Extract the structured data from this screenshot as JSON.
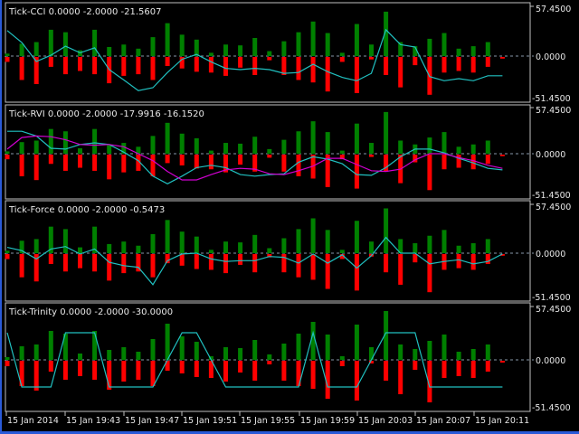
{
  "colors": {
    "background": "#000000",
    "frame": "#c0c0c0",
    "zero_line": "#8899aa",
    "bull": "#008000",
    "bear": "#ff0000",
    "line1": "#20c0c0",
    "line2": "#d000d0",
    "window_border": "#2a5ad8"
  },
  "time_axis": {
    "labels": [
      "15 Jan 2014",
      "15 Jan 19:43",
      "15 Jan 19:47",
      "15 Jan 19:51",
      "15 Jan 19:55",
      "15 Jan 19:59",
      "15 Jan 20:03",
      "15 Jan 20:07",
      "15 Jan 20:11"
    ]
  },
  "chart_data": [
    {
      "type": "bar+line",
      "title": "Tick-CCI 0.0000 -2.0000 -21.5607",
      "ylim": [
        -51.45,
        57.45
      ],
      "axis_labels": {
        "top": "57.4500",
        "zero": "0.0000",
        "bottom": "-51.4500"
      },
      "up": [
        3,
        15,
        17,
        32,
        29,
        7,
        32,
        11,
        14,
        9,
        23,
        40,
        26,
        20,
        4,
        14,
        13,
        22,
        6,
        18,
        29,
        42,
        28,
        4,
        39,
        14,
        54,
        17,
        12,
        21,
        28,
        9,
        12,
        17,
        0
      ],
      "down": [
        -6,
        -28,
        -33,
        -12,
        -21,
        -17,
        -21,
        -32,
        -23,
        -21,
        -28,
        -11,
        -14,
        -18,
        -19,
        -23,
        -13,
        -22,
        -4,
        -22,
        -28,
        -31,
        -42,
        -6,
        -44,
        -3,
        -22,
        -37,
        -10,
        -46,
        -19,
        -17,
        -19,
        -12,
        -2
      ],
      "lines": [
        {
          "name": "CCI",
          "color": "#20c0c0",
          "values": [
            31,
            16.5,
            -6.6,
            1,
            12,
            4,
            10,
            -16.5,
            -29,
            -42,
            -38.5,
            -20,
            -4,
            2,
            -7,
            -15,
            -16.5,
            -15,
            -16.5,
            -21,
            -20,
            -10,
            -19,
            -26,
            -30,
            -21,
            32,
            14,
            11,
            -25,
            -30,
            -27.5,
            -30,
            -24,
            -24
          ]
        }
      ]
    },
    {
      "type": "bar+line",
      "title": "Tick-RVI 0.0000 -2.0000 -17.9916 -16.1520",
      "ylim": [
        -51.45,
        57.45
      ],
      "axis_labels": {
        "top": "57.4500",
        "zero": "0.0000",
        "bottom": "-51.4500"
      },
      "up": [
        3,
        15,
        17,
        32,
        29,
        7,
        32,
        11,
        14,
        9,
        23,
        40,
        26,
        20,
        4,
        14,
        13,
        22,
        6,
        18,
        29,
        42,
        28,
        4,
        39,
        14,
        54,
        17,
        12,
        21,
        28,
        9,
        12,
        17,
        0
      ],
      "down": [
        -6,
        -28,
        -33,
        -12,
        -21,
        -17,
        -21,
        -32,
        -23,
        -21,
        -28,
        -11,
        -14,
        -18,
        -19,
        -23,
        -13,
        -22,
        -4,
        -22,
        -28,
        -31,
        -42,
        -6,
        -44,
        -3,
        -22,
        -37,
        -10,
        -46,
        -19,
        -17,
        -19,
        -12,
        -2
      ],
      "lines": [
        {
          "name": "RVI",
          "color": "#20c0c0",
          "values": [
            29,
            29,
            23,
            7,
            6,
            12,
            14,
            12,
            2,
            -9,
            -29,
            -39,
            -29,
            -18,
            -15,
            -18,
            -27,
            -29,
            -27,
            -26,
            -11,
            -4,
            -7,
            -13,
            -27,
            -28,
            -18,
            -4,
            6,
            6,
            1,
            -6,
            -12,
            -19,
            -21
          ]
        },
        {
          "name": "Signal",
          "color": "#d000d0",
          "values": [
            6,
            21,
            23,
            22,
            18,
            12,
            11,
            12,
            9,
            0,
            -9,
            -23,
            -34,
            -34,
            -27,
            -21,
            -19,
            -20,
            -26,
            -27,
            -22,
            -16,
            -6,
            -6,
            -14,
            -22,
            -23,
            -20,
            -8,
            0,
            0,
            -5,
            -9,
            -15,
            -19
          ]
        }
      ]
    },
    {
      "type": "bar+line",
      "title": "Tick-Force 0.0000 -2.0000 -0.5473",
      "ylim": [
        -51.45,
        57.45
      ],
      "axis_labels": {
        "top": "57.4500",
        "zero": "0.0000",
        "bottom": "-51.4500"
      },
      "up": [
        3,
        15,
        17,
        32,
        29,
        7,
        32,
        11,
        14,
        9,
        23,
        40,
        26,
        20,
        4,
        14,
        13,
        22,
        6,
        18,
        29,
        42,
        28,
        4,
        39,
        14,
        54,
        17,
        12,
        21,
        28,
        9,
        12,
        17,
        0
      ],
      "down": [
        -6,
        -28,
        -33,
        -12,
        -21,
        -17,
        -21,
        -32,
        -23,
        -21,
        -28,
        -11,
        -14,
        -18,
        -19,
        -23,
        -13,
        -22,
        -4,
        -22,
        -28,
        -31,
        -42,
        -6,
        -44,
        -3,
        -22,
        -37,
        -10,
        -46,
        -19,
        -17,
        -19,
        -12,
        -2
      ],
      "lines": [
        {
          "name": "Force",
          "color": "#20c0c0",
          "values": [
            7,
            3,
            -7,
            5,
            8,
            -1,
            5,
            -11,
            -15,
            -17,
            -38,
            -9,
            -1,
            0,
            -7,
            -10,
            -9,
            -9,
            -4,
            -5,
            -12,
            -1,
            -12,
            -2,
            -18,
            -3,
            19,
            0,
            0,
            -13,
            -10,
            -8,
            -13,
            -10,
            -1
          ]
        }
      ]
    },
    {
      "type": "bar+line",
      "title": "Tick-Trinity 0.0000 -2.0000 -30.0000",
      "ylim": [
        -51.45,
        57.45
      ],
      "axis_labels": {
        "top": "57.4500",
        "zero": "0.0000",
        "bottom": "-51.4500"
      },
      "up": [
        3,
        15,
        17,
        32,
        29,
        7,
        32,
        11,
        14,
        9,
        23,
        40,
        26,
        20,
        4,
        14,
        13,
        22,
        6,
        18,
        29,
        42,
        28,
        4,
        39,
        14,
        54,
        17,
        12,
        21,
        28,
        9,
        12,
        17,
        0
      ],
      "down": [
        -6,
        -28,
        -33,
        -12,
        -21,
        -17,
        -21,
        -32,
        -23,
        -21,
        -28,
        -11,
        -14,
        -18,
        -19,
        -23,
        -13,
        -22,
        -4,
        -22,
        -28,
        -31,
        -42,
        -6,
        -44,
        -3,
        -22,
        -37,
        -10,
        -46,
        -19,
        -17,
        -19,
        -12,
        -2
      ],
      "lines": [
        {
          "name": "Trinity",
          "color": "#20c0c0",
          "values": [
            30,
            -30,
            -30,
            -30,
            30,
            30,
            30,
            -30,
            -30,
            -30,
            -30,
            0,
            30,
            30,
            0,
            -30,
            -30,
            -30,
            -30,
            -30,
            -30,
            30,
            -30,
            -30,
            -30,
            0,
            30,
            30,
            30,
            -30,
            -30,
            -30,
            -30,
            -30,
            -30
          ]
        }
      ]
    }
  ]
}
